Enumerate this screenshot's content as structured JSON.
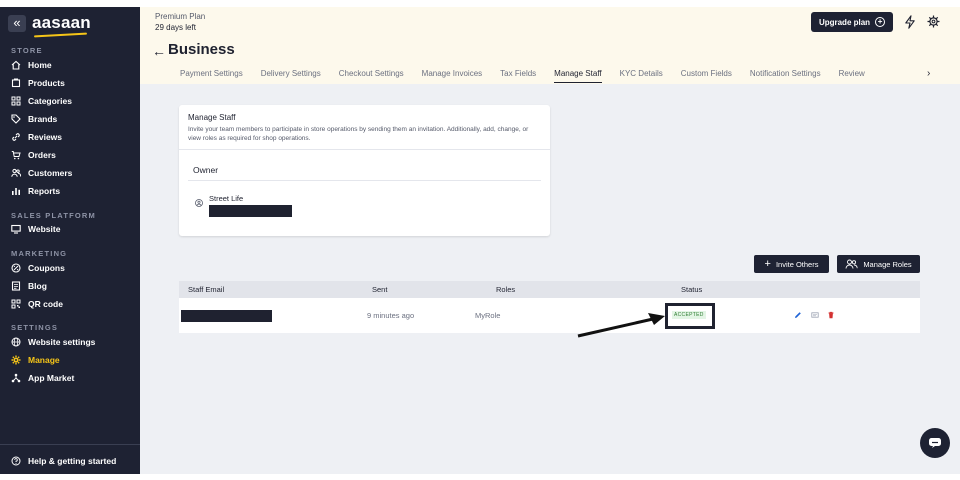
{
  "sidebar": {
    "collapse_icon": "«",
    "brand": "aasaan",
    "sections": [
      {
        "label": "STORE",
        "items": [
          "Home",
          "Products",
          "Categories",
          "Brands",
          "Reviews",
          "Orders",
          "Customers",
          "Reports"
        ]
      },
      {
        "label": "SALES PLATFORM",
        "items": [
          "Website"
        ]
      },
      {
        "label": "MARKETING",
        "items": [
          "Coupons",
          "Blog",
          "QR code"
        ]
      },
      {
        "label": "SETTINGS",
        "items": [
          "Website settings",
          "Manage",
          "App Market"
        ]
      }
    ],
    "active_item": "Manage",
    "help": "Help & getting started"
  },
  "header": {
    "plan_name": "Premium Plan",
    "plan_days": "29 days left",
    "upgrade_label": "Upgrade plan",
    "upgrade_icon": "+",
    "title": "Business",
    "back_icon": "←",
    "tab_chevron": "›",
    "tabs": [
      "Payment Settings",
      "Delivery Settings",
      "Checkout Settings",
      "Manage Invoices",
      "Tax Fields",
      "Manage Staff",
      "KYC Details",
      "Custom Fields",
      "Notification Settings",
      "Review"
    ],
    "active_tab": "Manage Staff"
  },
  "manage_staff": {
    "title": "Manage Staff",
    "description": "Invite your team members to participate in store operations by sending them an invitation. Additionally, add, change, or view roles as required for shop operations.",
    "owner_label": "Owner",
    "owner_name": "Street Life"
  },
  "actions": {
    "invite_label": "Invite Others",
    "invite_icon": "+",
    "roles_label": "Manage Roles"
  },
  "table": {
    "columns": [
      "Staff Email",
      "Sent",
      "Roles",
      "Status"
    ],
    "rows": [
      {
        "sent": "9 minutes ago",
        "role": "MyRole",
        "status": "ACCEPTED"
      }
    ]
  },
  "colors": {
    "sidebar_bg": "#1e2233",
    "accent": "#f5c518",
    "accepted_text": "#2e7d32",
    "delete": "#d32f2f",
    "edit": "#1e63d6"
  }
}
